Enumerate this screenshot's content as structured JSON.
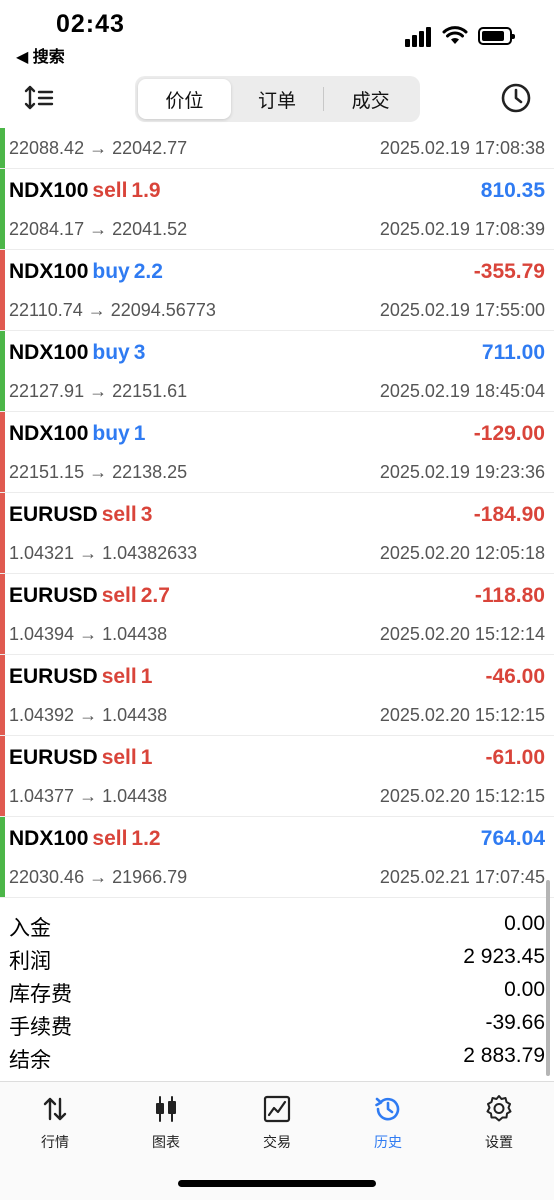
{
  "status": {
    "time": "02:43",
    "back_label": "◀ 搜索"
  },
  "segments": [
    {
      "label": "价位",
      "active": true
    },
    {
      "label": "订单",
      "active": false
    },
    {
      "label": "成交",
      "active": false
    }
  ],
  "colors": {
    "buy": "#2f7bf2",
    "sell": "#d9443a",
    "profit_pos": "#2f7bf2",
    "profit_neg": "#d9443a",
    "bar_green": "#4cb648",
    "bar_red": "#e05a50"
  },
  "deals": [
    {
      "symbol": "",
      "side": "",
      "side_type": "",
      "volume": "",
      "profit": "",
      "profit_sign": "pos",
      "prices": "22088.42 → 22042.77",
      "time": "2025.02.19 17:08:38",
      "bar": "green"
    },
    {
      "symbol": "NDX100",
      "side": "sell",
      "side_type": "sell",
      "volume": "1.9",
      "profit": "810.35",
      "profit_sign": "pos",
      "prices": "22084.17 → 22041.52",
      "time": "2025.02.19 17:08:39",
      "bar": "green"
    },
    {
      "symbol": "NDX100",
      "side": "buy",
      "side_type": "buy",
      "volume": "2.2",
      "profit": "-355.79",
      "profit_sign": "neg",
      "prices": "22110.74 → 22094.56773",
      "time": "2025.02.19 17:55:00",
      "bar": "red"
    },
    {
      "symbol": "NDX100",
      "side": "buy",
      "side_type": "buy",
      "volume": "3",
      "profit": "711.00",
      "profit_sign": "pos",
      "prices": "22127.91 → 22151.61",
      "time": "2025.02.19 18:45:04",
      "bar": "green"
    },
    {
      "symbol": "NDX100",
      "side": "buy",
      "side_type": "buy",
      "volume": "1",
      "profit": "-129.00",
      "profit_sign": "neg",
      "prices": "22151.15 → 22138.25",
      "time": "2025.02.19 19:23:36",
      "bar": "red"
    },
    {
      "symbol": "EURUSD",
      "side": "sell",
      "side_type": "sell",
      "volume": "3",
      "profit": "-184.90",
      "profit_sign": "neg",
      "prices": "1.04321 → 1.04382633",
      "time": "2025.02.20 12:05:18",
      "bar": "red"
    },
    {
      "symbol": "EURUSD",
      "side": "sell",
      "side_type": "sell",
      "volume": "2.7",
      "profit": "-118.80",
      "profit_sign": "neg",
      "prices": "1.04394 → 1.04438",
      "time": "2025.02.20 15:12:14",
      "bar": "red"
    },
    {
      "symbol": "EURUSD",
      "side": "sell",
      "side_type": "sell",
      "volume": "1",
      "profit": "-46.00",
      "profit_sign": "neg",
      "prices": "1.04392 → 1.04438",
      "time": "2025.02.20 15:12:15",
      "bar": "red"
    },
    {
      "symbol": "EURUSD",
      "side": "sell",
      "side_type": "sell",
      "volume": "1",
      "profit": "-61.00",
      "profit_sign": "neg",
      "prices": "1.04377 → 1.04438",
      "time": "2025.02.20 15:12:15",
      "bar": "red"
    },
    {
      "symbol": "NDX100",
      "side": "sell",
      "side_type": "sell",
      "volume": "1.2",
      "profit": "764.04",
      "profit_sign": "pos",
      "prices": "22030.46 → 21966.79",
      "time": "2025.02.21 17:07:45",
      "bar": "green"
    }
  ],
  "summary": [
    {
      "label": "入金",
      "value": "0.00"
    },
    {
      "label": "利润",
      "value": "2 923.45"
    },
    {
      "label": "库存费",
      "value": "0.00"
    },
    {
      "label": "手续费",
      "value": "-39.66"
    },
    {
      "label": "结余",
      "value": "2 883.79"
    }
  ],
  "tabs": [
    {
      "label": "行情",
      "icon": "quotes-icon",
      "active": false
    },
    {
      "label": "图表",
      "icon": "chart-icon",
      "active": false
    },
    {
      "label": "交易",
      "icon": "trade-icon",
      "active": false
    },
    {
      "label": "历史",
      "icon": "history-icon",
      "active": true
    },
    {
      "label": "设置",
      "icon": "settings-icon",
      "active": false
    }
  ]
}
